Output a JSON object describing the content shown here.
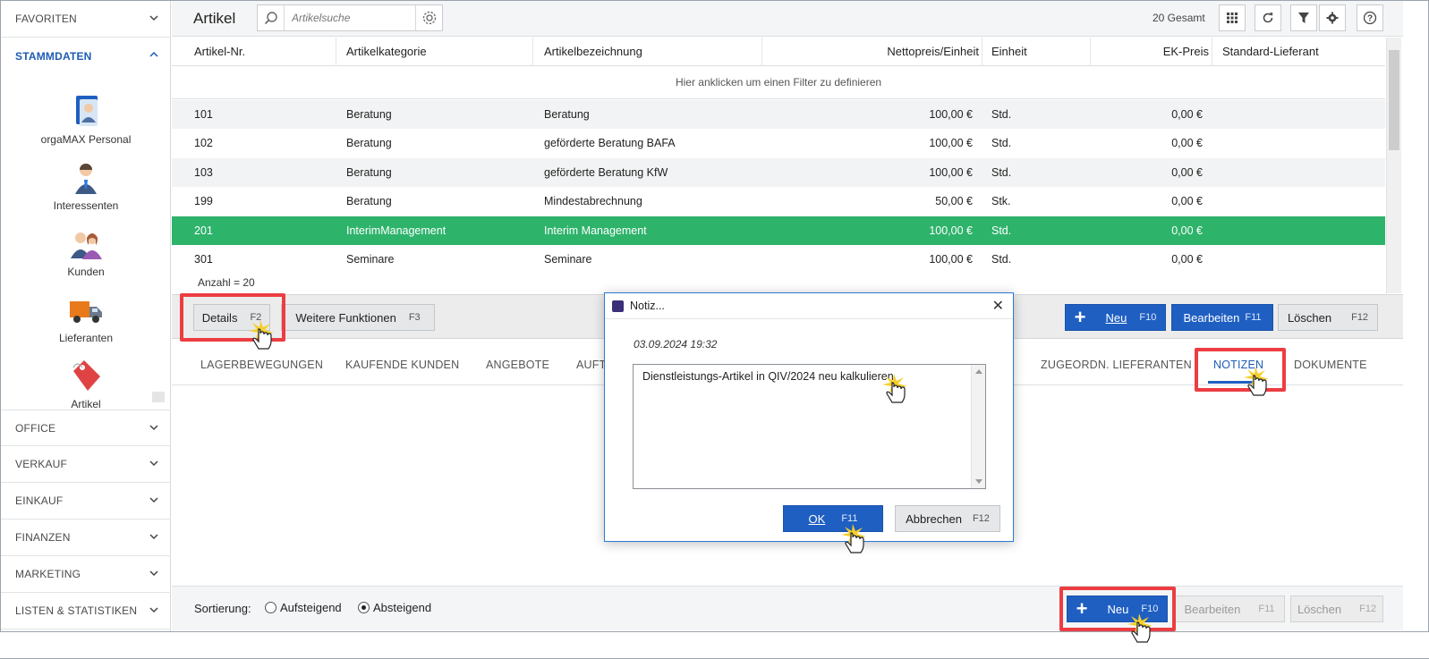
{
  "sidebar": {
    "sections_top": [
      {
        "label": "FAVORITEN",
        "state": "collapsed"
      },
      {
        "label": "STAMMDATEN",
        "state": "expanded"
      }
    ],
    "items": [
      {
        "label": "orgaMAX Personal",
        "icon": "personal-card-icon"
      },
      {
        "label": "Interessenten",
        "icon": "person-icon"
      },
      {
        "label": "Kunden",
        "icon": "customers-icon"
      },
      {
        "label": "Lieferanten",
        "icon": "truck-icon"
      },
      {
        "label": "Artikel",
        "icon": "tag-icon"
      }
    ],
    "sections_bottom": [
      {
        "label": "OFFICE"
      },
      {
        "label": "VERKAUF"
      },
      {
        "label": "EINKAUF"
      },
      {
        "label": "FINANZEN"
      },
      {
        "label": "MARKETING"
      },
      {
        "label": "LISTEN & STATISTIKEN"
      }
    ]
  },
  "header": {
    "title": "Artikel",
    "search_placeholder": "Artikelsuche",
    "total": "20 Gesamt",
    "toolbar_icons": [
      "grid-icon",
      "refresh-icon",
      "filter-icon",
      "settings-icon",
      "help-icon"
    ]
  },
  "table": {
    "columns": [
      "Artikel-Nr.",
      "Artikelkategorie",
      "Artikelbezeichnung",
      "Nettopreis/Einheit",
      "Einheit",
      "EK-Preis",
      "Standard-Lieferant"
    ],
    "filter_hint": "Hier anklicken um einen Filter zu definieren",
    "rows": [
      {
        "nr": "101",
        "kategorie": "Beratung",
        "bezeichnung": "Beratung",
        "preis": "100,00 €",
        "einheit": "Std.",
        "ek": "0,00 €",
        "lieferant": "",
        "selected": false
      },
      {
        "nr": "102",
        "kategorie": "Beratung",
        "bezeichnung": "geförderte Beratung BAFA",
        "preis": "100,00 €",
        "einheit": "Std.",
        "ek": "0,00 €",
        "lieferant": "",
        "selected": false
      },
      {
        "nr": "103",
        "kategorie": "Beratung",
        "bezeichnung": "geförderte Beratung KfW",
        "preis": "100,00 €",
        "einheit": "Std.",
        "ek": "0,00 €",
        "lieferant": "",
        "selected": false
      },
      {
        "nr": "199",
        "kategorie": "Beratung",
        "bezeichnung": "Mindestabrechnung",
        "preis": "50,00 €",
        "einheit": "Stk.",
        "ek": "0,00 €",
        "lieferant": "",
        "selected": false
      },
      {
        "nr": "201",
        "kategorie": "InterimManagement",
        "bezeichnung": "Interim Management",
        "preis": "100,00 €",
        "einheit": "Std.",
        "ek": "0,00 €",
        "lieferant": "",
        "selected": true
      },
      {
        "nr": "301",
        "kategorie": "Seminare",
        "bezeichnung": "Seminare",
        "preis": "100,00 €",
        "einheit": "Std.",
        "ek": "0,00 €",
        "lieferant": "",
        "selected": false
      }
    ],
    "count": "Anzahl = 20"
  },
  "actions": {
    "details": {
      "label": "Details",
      "key": "F2"
    },
    "weitere": {
      "label": "Weitere Funktionen",
      "key": "F3"
    },
    "neu": {
      "label": "Neu",
      "key": "F10"
    },
    "bearbeiten": {
      "label": "Bearbeiten",
      "key": "F11"
    },
    "loeschen": {
      "label": "Löschen",
      "key": "F12"
    }
  },
  "tabs": [
    {
      "label": "LAGERBEWEGUNGEN"
    },
    {
      "label": "KAUFENDE KUNDEN"
    },
    {
      "label": "ANGEBOTE"
    },
    {
      "label": "AUFT"
    },
    {
      "label": "ZUGEORDN. LIEFERANTEN"
    },
    {
      "label": "NOTIZEN",
      "active": true
    },
    {
      "label": "DOKUMENTE"
    }
  ],
  "bottom": {
    "sort_label": "Sortierung:",
    "asc": "Aufsteigend",
    "desc": "Absteigend",
    "selected": "desc",
    "neu": {
      "label": "Neu",
      "key": "F10"
    },
    "bearbeiten": {
      "label": "Bearbeiten",
      "key": "F11"
    },
    "loeschen": {
      "label": "Löschen",
      "key": "F12"
    }
  },
  "dialog": {
    "title": "Notiz...",
    "date": "03.09.2024 19:32",
    "text": "Dienstleistungs-Artikel in QIV/2024 neu kalkulieren",
    "ok": {
      "label": "OK",
      "key": "F11"
    },
    "cancel": {
      "label": "Abbrechen",
      "key": "F12"
    }
  },
  "colors": {
    "accent": "#1f5fc2",
    "selected_row": "#2eb36b",
    "highlight_box": "#ec3d42"
  }
}
